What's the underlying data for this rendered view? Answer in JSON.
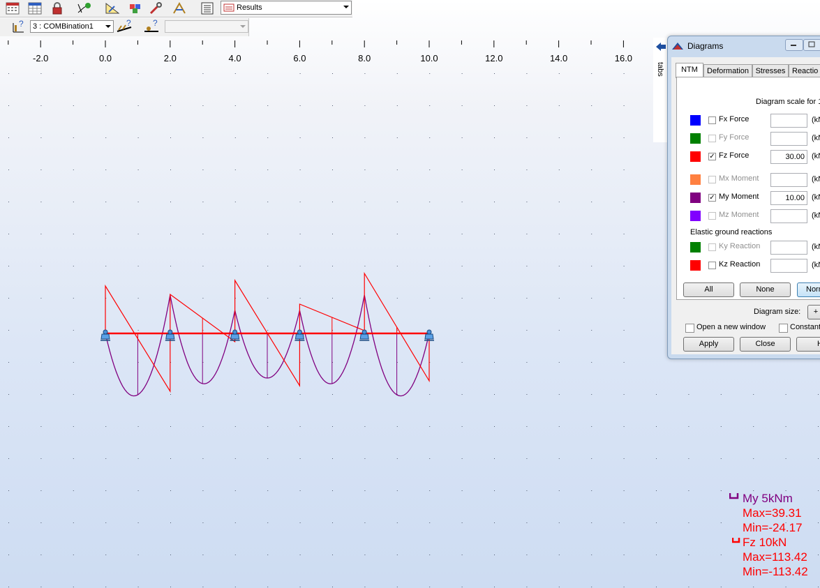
{
  "toolbar1": {
    "results_combo": "Results",
    "icons": [
      "calculator-icon",
      "table-icon",
      "lock-icon",
      "node-select-icon",
      "geometry-icon",
      "model-icon",
      "tools-icon",
      "drawing-icon",
      "report-icon",
      "results-icon"
    ]
  },
  "toolbar2": {
    "load_case_combo": "3 : COMBination1",
    "second_combo": ""
  },
  "ruler": {
    "labels": [
      "-2.0",
      "0.0",
      "2.0",
      "4.0",
      "6.0",
      "8.0",
      "10.0",
      "12.0",
      "14.0",
      "16.0"
    ]
  },
  "side_panel": {
    "tabs_label": "tabs"
  },
  "dialog": {
    "title": "Diagrams",
    "tabs": [
      "NTM",
      "Deformation",
      "Stresses",
      "Reactio"
    ],
    "scale_label": "Diagram scale for 1",
    "rows": [
      {
        "color": "#0000ff",
        "label": "Fx Force",
        "checked": false,
        "enabled": true,
        "value": "",
        "unit": "(kN"
      },
      {
        "color": "#008000",
        "label": "Fy Force",
        "checked": false,
        "enabled": false,
        "value": "",
        "unit": "(kN"
      },
      {
        "color": "#ff0000",
        "label": "Fz Force",
        "checked": true,
        "enabled": true,
        "value": "30.00",
        "unit": "(kN"
      },
      {
        "color": "#ff8040",
        "label": "Mx Moment",
        "checked": false,
        "enabled": false,
        "value": "",
        "unit": "(kN"
      },
      {
        "color": "#800080",
        "label": "My Moment",
        "checked": true,
        "enabled": true,
        "value": "10.00",
        "unit": "(kN"
      },
      {
        "color": "#8000ff",
        "label": "Mz Moment",
        "checked": false,
        "enabled": false,
        "value": "",
        "unit": "(kN"
      }
    ],
    "elastic_label": "Elastic ground reactions",
    "elastic_rows": [
      {
        "color": "#008000",
        "label": "Ky Reaction",
        "checked": false,
        "enabled": false,
        "value": "",
        "unit": "(kN"
      },
      {
        "color": "#ff0000",
        "label": "Kz Reaction",
        "checked": false,
        "enabled": true,
        "value": "",
        "unit": "(kN"
      }
    ],
    "btn_all": "All",
    "btn_none": "None",
    "btn_norm": "Norm",
    "diagram_size_label": "Diagram size:",
    "plus_label": "+",
    "open_new_window": "Open a new window",
    "constant": "Constant",
    "btn_apply": "Apply",
    "btn_close": "Close",
    "btn_help": "H"
  },
  "legend": {
    "my_title": "My  5kNm",
    "my_max": "Max=39.31",
    "my_min": "Min=-24.17",
    "fz_title": "Fz  10kN",
    "fz_max": "Max=113.42",
    "fz_min": "Min=-113.42",
    "my_color": "#800080",
    "fz_color": "#ff0000"
  },
  "beam": {
    "supports_at": [
      0,
      2,
      4,
      6,
      8,
      10
    ],
    "color": "#ff0000"
  }
}
